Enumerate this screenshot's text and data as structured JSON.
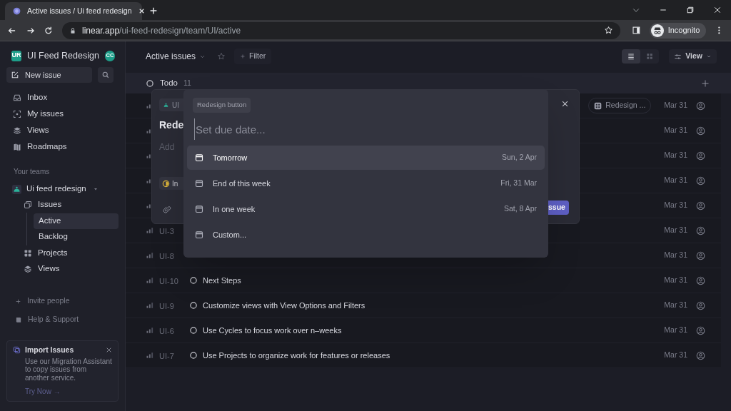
{
  "browser": {
    "tab_title": "Active issues / Ui feed redesign",
    "url_domain": "linear.app",
    "url_path": "/ui-feed-redesign/team/UI/active",
    "profile": "Incognito"
  },
  "sidebar": {
    "workspace": "UI Feed Redesign",
    "workspace_initials": "UR",
    "user_initials": "CC",
    "new_issue": "New issue",
    "nav": [
      {
        "kind": "inbox",
        "label": "Inbox"
      },
      {
        "kind": "my-issues",
        "label": "My issues"
      },
      {
        "kind": "views",
        "label": "Views"
      },
      {
        "kind": "roadmaps",
        "label": "Roadmaps"
      }
    ],
    "teams_heading": "Your teams",
    "team": {
      "name": "Ui feed redesign",
      "expanded": true,
      "children": [
        {
          "kind": "issues",
          "label": "Issues",
          "selected": false,
          "children": [
            {
              "label": "Active",
              "selected": true
            },
            {
              "label": "Backlog",
              "selected": false
            }
          ]
        },
        {
          "kind": "projects",
          "label": "Projects",
          "selected": false
        },
        {
          "kind": "views",
          "label": "Views",
          "selected": false
        }
      ]
    },
    "invite": "Invite people",
    "help": "Help & Support",
    "promo": {
      "title": "Import Issues",
      "body": "Use our Migration Assistant to copy issues from another service.",
      "link": "Try Now →"
    }
  },
  "main": {
    "title": "Active issues",
    "filter": "Filter",
    "layouts": [
      {
        "kind": "list",
        "selected": true
      },
      {
        "kind": "board",
        "selected": false
      }
    ],
    "view": "View",
    "group": {
      "name": "Todo",
      "count": "11"
    },
    "rows": [
      {
        "label": "Redesign ...",
        "date": "Mar 31"
      },
      {
        "date": "Mar 31"
      },
      {
        "date": "Mar 31"
      },
      {
        "date": "Mar 31"
      },
      {
        "date": "Mar 31"
      },
      {
        "id": "UI-3",
        "date": "Mar 31"
      },
      {
        "id": "UI-8",
        "date": "Mar 31"
      },
      {
        "id": "UI-10",
        "title": "Next Steps",
        "date": "Mar 31"
      },
      {
        "id": "UI-9",
        "title": "Customize views with View Options and Filters",
        "date": "Mar 31"
      },
      {
        "id": "UI-6",
        "title": "Use Cycles to focus work over n–weeks",
        "date": "Mar 31"
      },
      {
        "id": "UI-7",
        "title": "Use Projects to organize work for features or releases",
        "date": "Mar 31"
      }
    ]
  },
  "modal": {
    "team": "UI",
    "title": "Rede",
    "placeholder": "Add",
    "status": "In",
    "submit": "ssue"
  },
  "popup": {
    "tag": "Redesign button",
    "placeholder": "Set due date...",
    "options": [
      {
        "label": "Tomorrow",
        "date": "Sun, 2 Apr",
        "selected": true
      },
      {
        "label": "End of this week",
        "date": "Fri, 31 Mar",
        "selected": false
      },
      {
        "label": "In one week",
        "date": "Sat, 8 Apr",
        "selected": false
      },
      {
        "label": "Custom...",
        "selected": false
      }
    ]
  }
}
